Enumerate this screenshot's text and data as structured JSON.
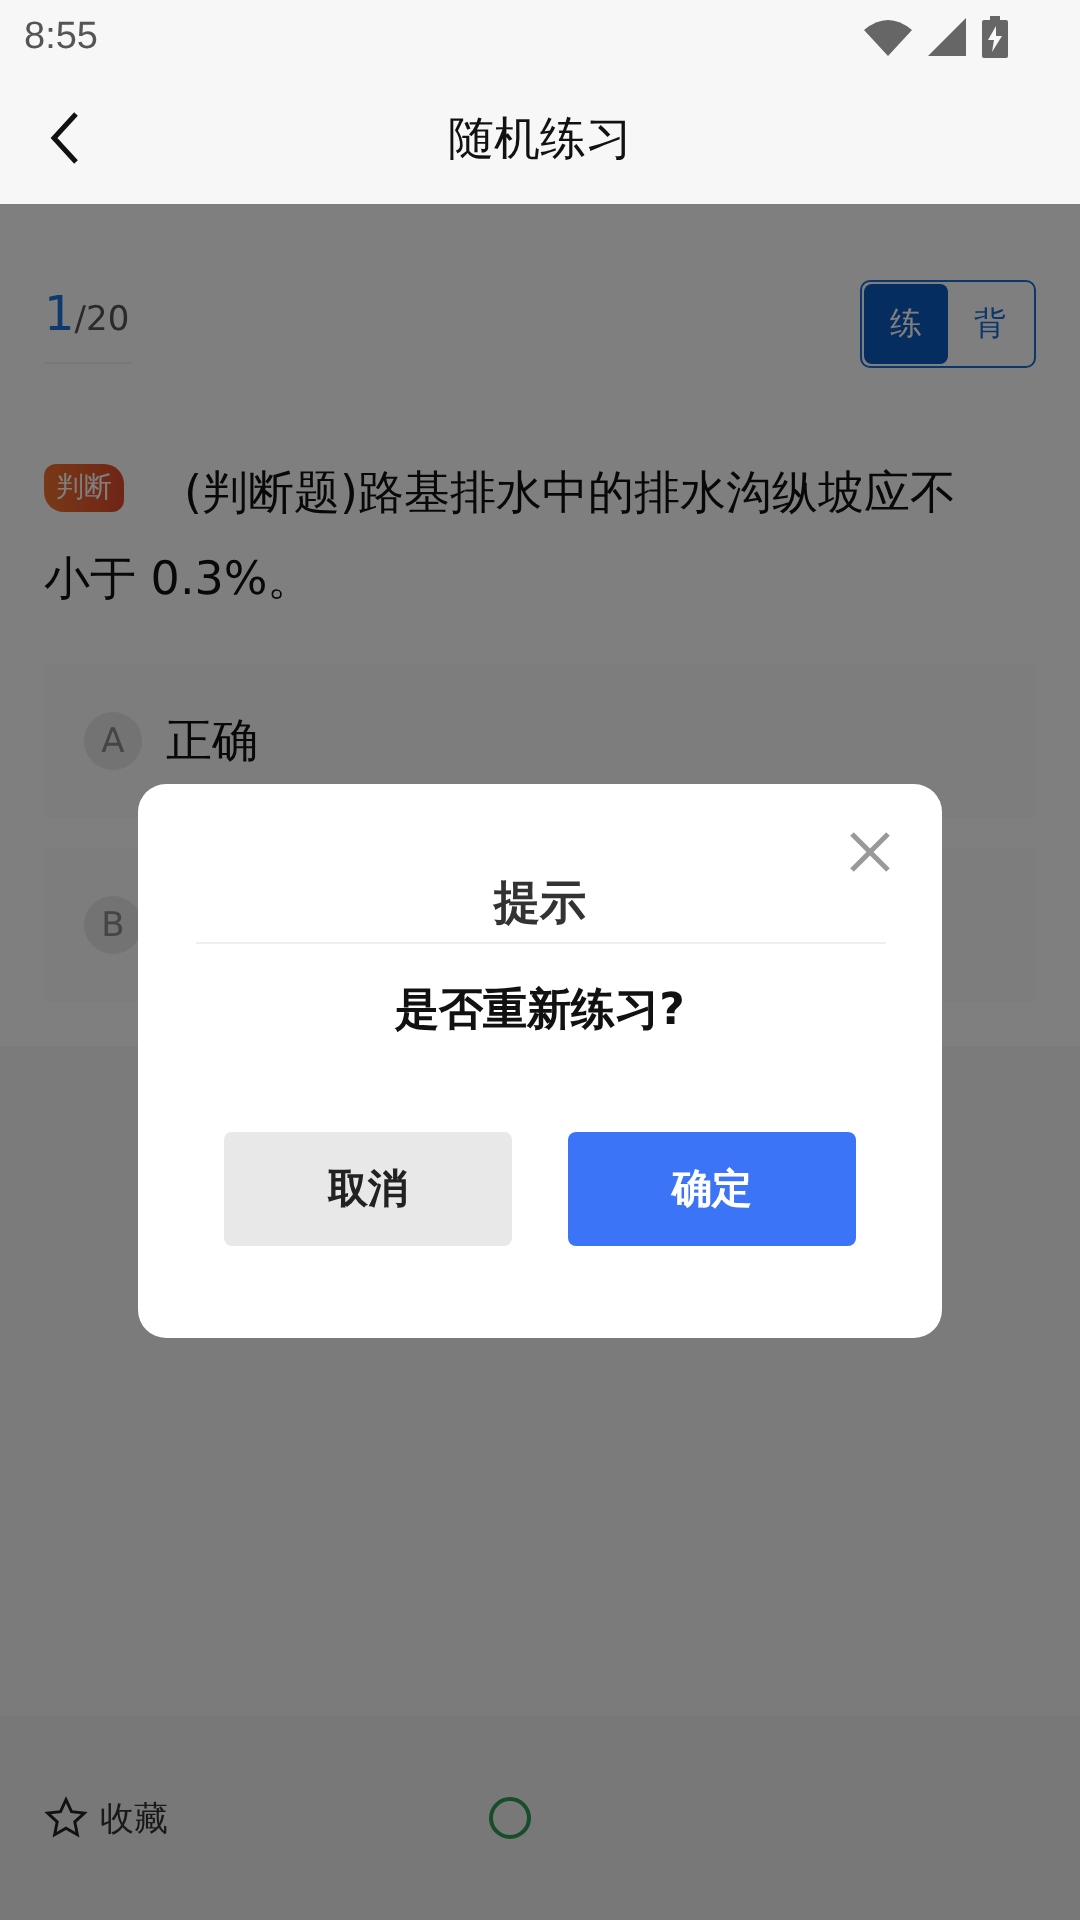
{
  "status_bar": {
    "time": "8:55"
  },
  "app_bar": {
    "title": "随机练习"
  },
  "progress": {
    "current": "1",
    "total": "/20"
  },
  "mode_toggle": [
    {
      "label": "练",
      "selected": true
    },
    {
      "label": "背",
      "selected": false
    }
  ],
  "question": {
    "tag": "判断",
    "text": "(判断题)路基排水中的排水沟纵坡应不小于 0.3%。"
  },
  "options": [
    {
      "letter": "A",
      "text": "正确"
    },
    {
      "letter": "B"
    }
  ],
  "bottom_bar": {
    "favorite": "收藏"
  },
  "dialog": {
    "title": "提示",
    "message": "是否重新练习?",
    "buttons": [
      {
        "label": "取消",
        "kind": "cancel"
      },
      {
        "label": "确定",
        "kind": "confirm"
      }
    ]
  }
}
